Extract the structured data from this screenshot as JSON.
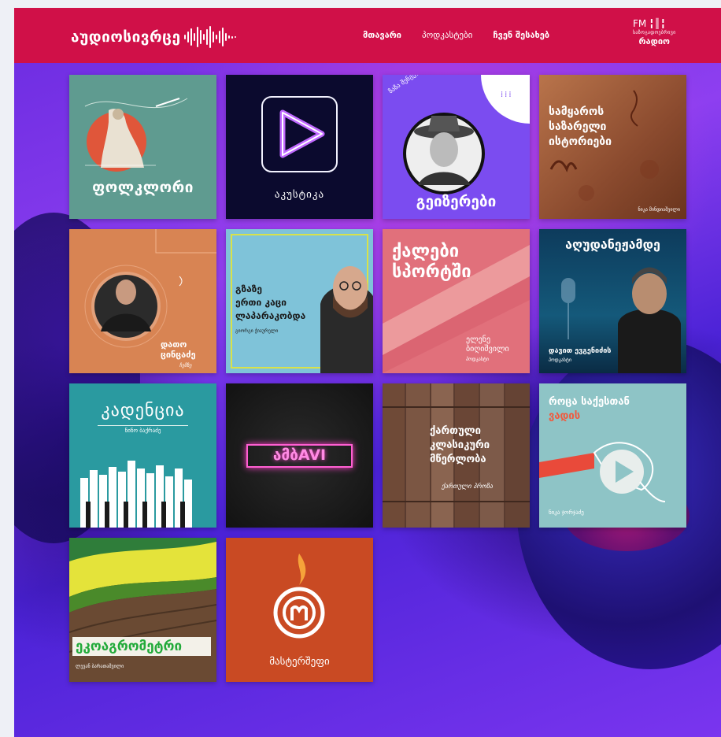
{
  "header": {
    "logo_text": "აუდიოსივრცე",
    "nav": [
      "მთავარი",
      "პოდკასტები",
      "ჩვენ შესახებ"
    ],
    "radio": {
      "fm": "FM",
      "small": "საზოგადოებრივი",
      "big": "რადიო"
    }
  },
  "cards": [
    {
      "id": "folklore",
      "title": "ფოლკლორი"
    },
    {
      "id": "akustika",
      "title": "აკუსტიკა"
    },
    {
      "id": "geizerebi",
      "title": "გეიზერები",
      "subtitle": "ზაზა შენგელია"
    },
    {
      "id": "istoriebi",
      "title_lines": [
        "სამყაროს",
        "საზარელი",
        "ისტორიები"
      ],
      "author": "ნიკა მინდიაშვილი"
    },
    {
      "id": "dato",
      "title_lines": [
        "დათო",
        "ცინცაძე"
      ],
      "script": "ჩემზე"
    },
    {
      "id": "lapara",
      "title_lines": [
        "გზაზე",
        "ერთი კაცი",
        "ლაპარაკობდა"
      ],
      "author": "გიორგი ჭიაურელი"
    },
    {
      "id": "kalebi",
      "title_lines": [
        "ქალები",
        "სპორტში"
      ],
      "author_lines": [
        "ელენე",
        "ბიღიშვილი"
      ],
      "tag": "პოდკასტი"
    },
    {
      "id": "audi",
      "title": "აღუდანეჟამდე",
      "author": "დავით ევგენიძის",
      "tag": "პოდკასტი"
    },
    {
      "id": "kadencia",
      "title": "კადენცია",
      "author": "ნინო ბაქრაძე"
    },
    {
      "id": "ambavi",
      "title": "ამბAVI"
    },
    {
      "id": "klasika",
      "title_lines": [
        "ქართული",
        "კლასიკური",
        "მწერლობა"
      ],
      "script": "ქართული პროზა"
    },
    {
      "id": "saqsestan",
      "title_line1": "როცა საქესთან",
      "title_line2": "ვადის",
      "author": "ნიკა ჯორჯაძე"
    },
    {
      "id": "eko",
      "title": "ეკოაგრომეტრი",
      "author": "ლევან ბარათაშვილი"
    },
    {
      "id": "master",
      "title": "მასტერშეფი"
    }
  ]
}
